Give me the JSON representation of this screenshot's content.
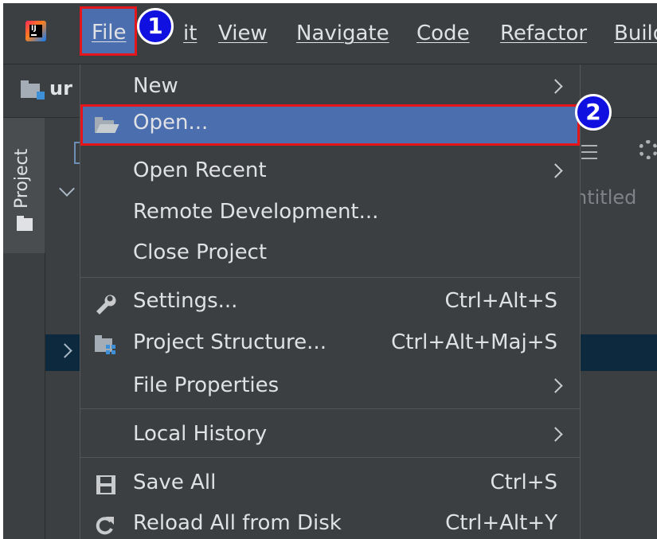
{
  "menubar": {
    "items": [
      {
        "id": "file",
        "label": "File"
      },
      {
        "id": "edit",
        "label": "Edit"
      },
      {
        "id": "view",
        "label": "View"
      },
      {
        "id": "navigate",
        "label": "Navigate"
      },
      {
        "id": "code",
        "label": "Code"
      },
      {
        "id": "refactor",
        "label": "Refactor"
      },
      {
        "id": "build",
        "label": "Build"
      }
    ],
    "edit_visible": "it"
  },
  "badges": {
    "step1": "1",
    "step2": "2"
  },
  "project": {
    "name_visible": "ur",
    "tool_window_label": "Project",
    "tree_hint": "ntitled"
  },
  "file_menu": {
    "items": [
      {
        "label": "New",
        "shortcut": "",
        "submenu": true
      },
      {
        "label": "Open...",
        "shortcut": "",
        "submenu": false,
        "icon": "open-folder-icon",
        "highlighted": true
      },
      {
        "label": "Open Recent",
        "shortcut": "",
        "submenu": true
      },
      {
        "label": "Remote Development...",
        "shortcut": "",
        "submenu": false
      },
      {
        "label": "Close Project",
        "shortcut": "",
        "submenu": false
      },
      {
        "label": "Settings...",
        "shortcut": "Ctrl+Alt+S",
        "submenu": false,
        "icon": "wrench-icon"
      },
      {
        "label": "Project Structure...",
        "shortcut": "Ctrl+Alt+Maj+S",
        "submenu": false,
        "icon": "project-structure-icon"
      },
      {
        "label": "File Properties",
        "shortcut": "",
        "submenu": true
      },
      {
        "label": "Local History",
        "shortcut": "",
        "submenu": true
      },
      {
        "label": "Save All",
        "shortcut": "Ctrl+S",
        "submenu": false,
        "icon": "save-icon"
      },
      {
        "label": "Reload All from Disk",
        "shortcut": "Ctrl+Alt+Y",
        "submenu": false,
        "icon": "reload-icon"
      }
    ]
  },
  "colors": {
    "background": "#3c3f41",
    "highlight": "#4b6eaf",
    "annotation_border": "#e5161b",
    "badge": "#1010e0",
    "text": "#dfe1e5"
  }
}
